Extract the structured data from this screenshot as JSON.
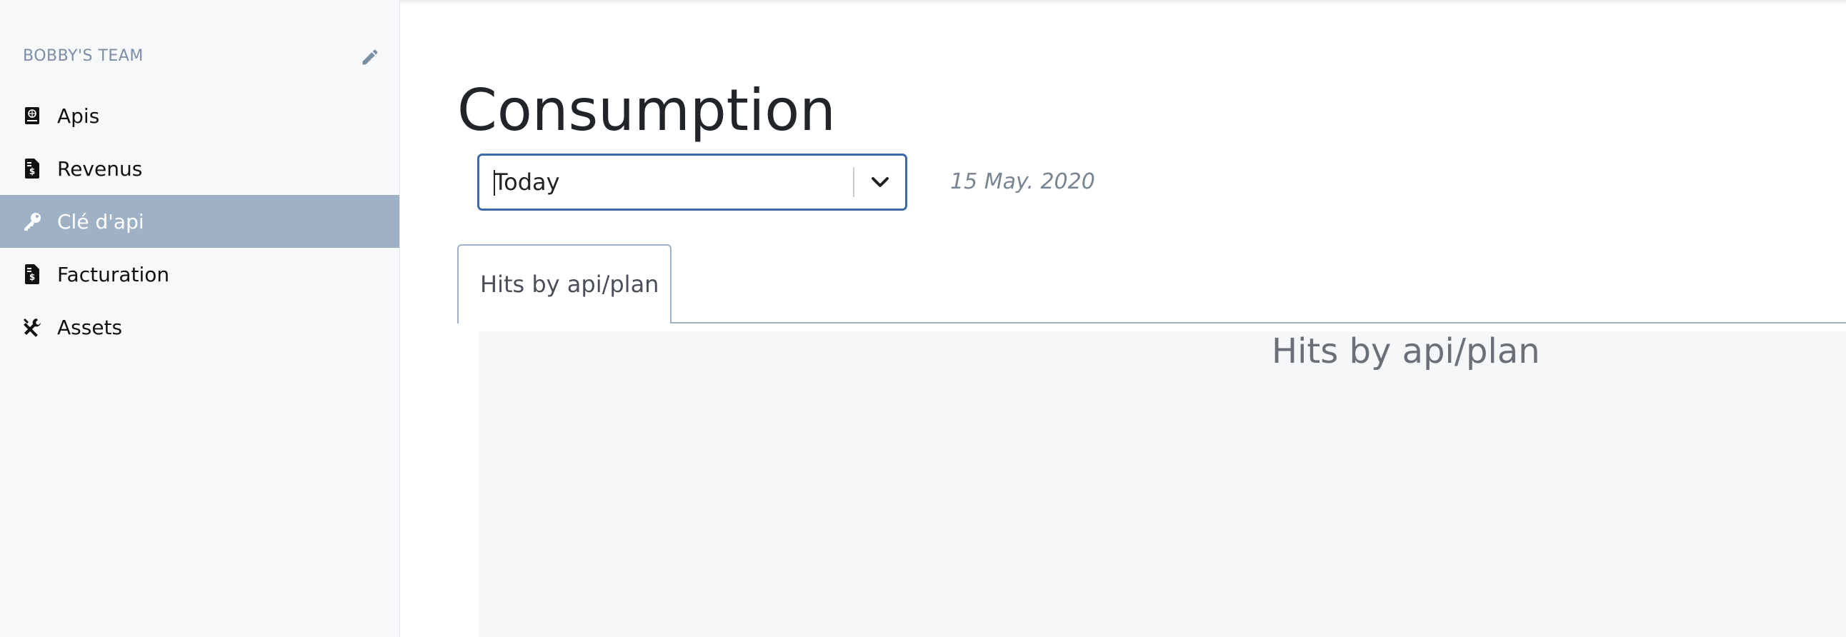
{
  "sidebar": {
    "team_name": "BOBBY'S TEAM",
    "items": [
      {
        "label": "Apis",
        "icon": "book-icon",
        "active": false
      },
      {
        "label": "Revenus",
        "icon": "invoice-dollar-icon",
        "active": false
      },
      {
        "label": "Clé d'api",
        "icon": "key-icon",
        "active": true
      },
      {
        "label": "Facturation",
        "icon": "invoice-dollar-icon",
        "active": false
      },
      {
        "label": "Assets",
        "icon": "tools-icon",
        "active": false
      }
    ]
  },
  "main": {
    "title": "Consumption",
    "period_select": {
      "value": "Today"
    },
    "date": "15 May. 2020",
    "tabs": [
      {
        "label": "Hits by api/plan",
        "active": true
      }
    ],
    "chart": {
      "title": "Hits by api/plan"
    }
  },
  "colors": {
    "accent": "#9fb1c5",
    "focus_border": "#3b6aa8",
    "sidebar_bg": "#f7f8fa"
  }
}
